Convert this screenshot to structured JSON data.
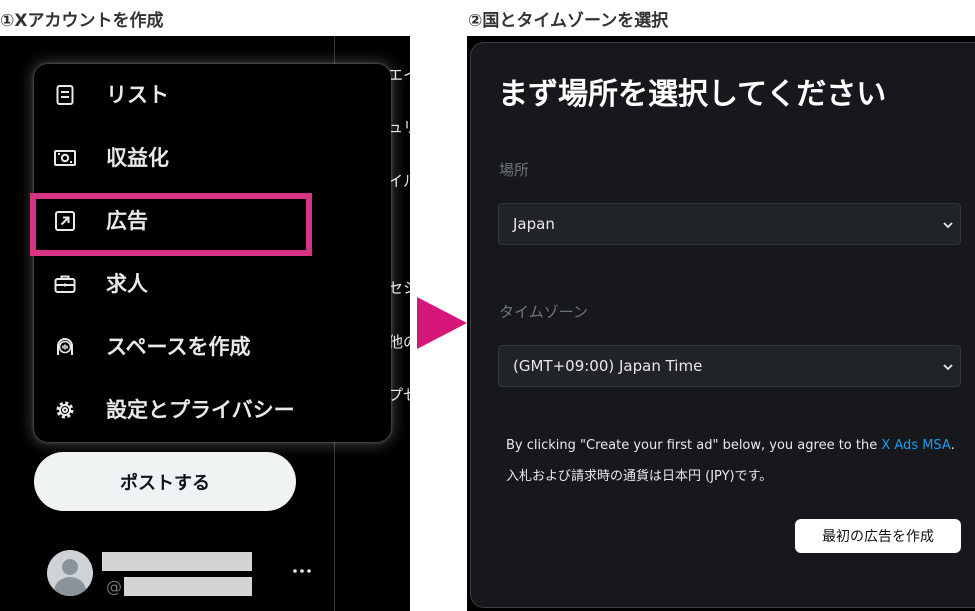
{
  "step1": {
    "title": "①Xアカウントを作成"
  },
  "step2": {
    "title": "②国とタイムゾーンを選択"
  },
  "background_texts": [
    "エイ",
    "ュリ",
    "イル",
    "セシ",
    "他の",
    "プセ"
  ],
  "menu": {
    "items": [
      {
        "label": "リスト",
        "icon": "list-icon"
      },
      {
        "label": "収益化",
        "icon": "money-icon"
      },
      {
        "label": "広告",
        "icon": "external-link-icon"
      },
      {
        "label": "求人",
        "icon": "briefcase-icon"
      },
      {
        "label": "スペースを作成",
        "icon": "spaces-mic-icon"
      },
      {
        "label": "設定とプライバシー",
        "icon": "gear-icon"
      }
    ]
  },
  "post_button": {
    "label": "ポストする"
  },
  "account": {
    "handle_prefix": "@"
  },
  "ads": {
    "heading": "まず場所を選択してください",
    "location_label": "場所",
    "location_value": "Japan",
    "timezone_label": "タイムゾーン",
    "timezone_value": "(GMT+09:00) Japan Time",
    "agreement_text": "By clicking \"Create your first ad\" below, you agree to the ",
    "msa_link": "X Ads MSA",
    "agreement_end": ".",
    "currency_note": "入札および請求時の通貨は日本円 (JPY)です。",
    "create_button": "最初の広告を作成"
  },
  "colors": {
    "highlight": "#d63384",
    "arrow": "#d6177a",
    "link": "#1d9bf0",
    "panel_bg": "#000000",
    "card_bg": "#16181c"
  }
}
